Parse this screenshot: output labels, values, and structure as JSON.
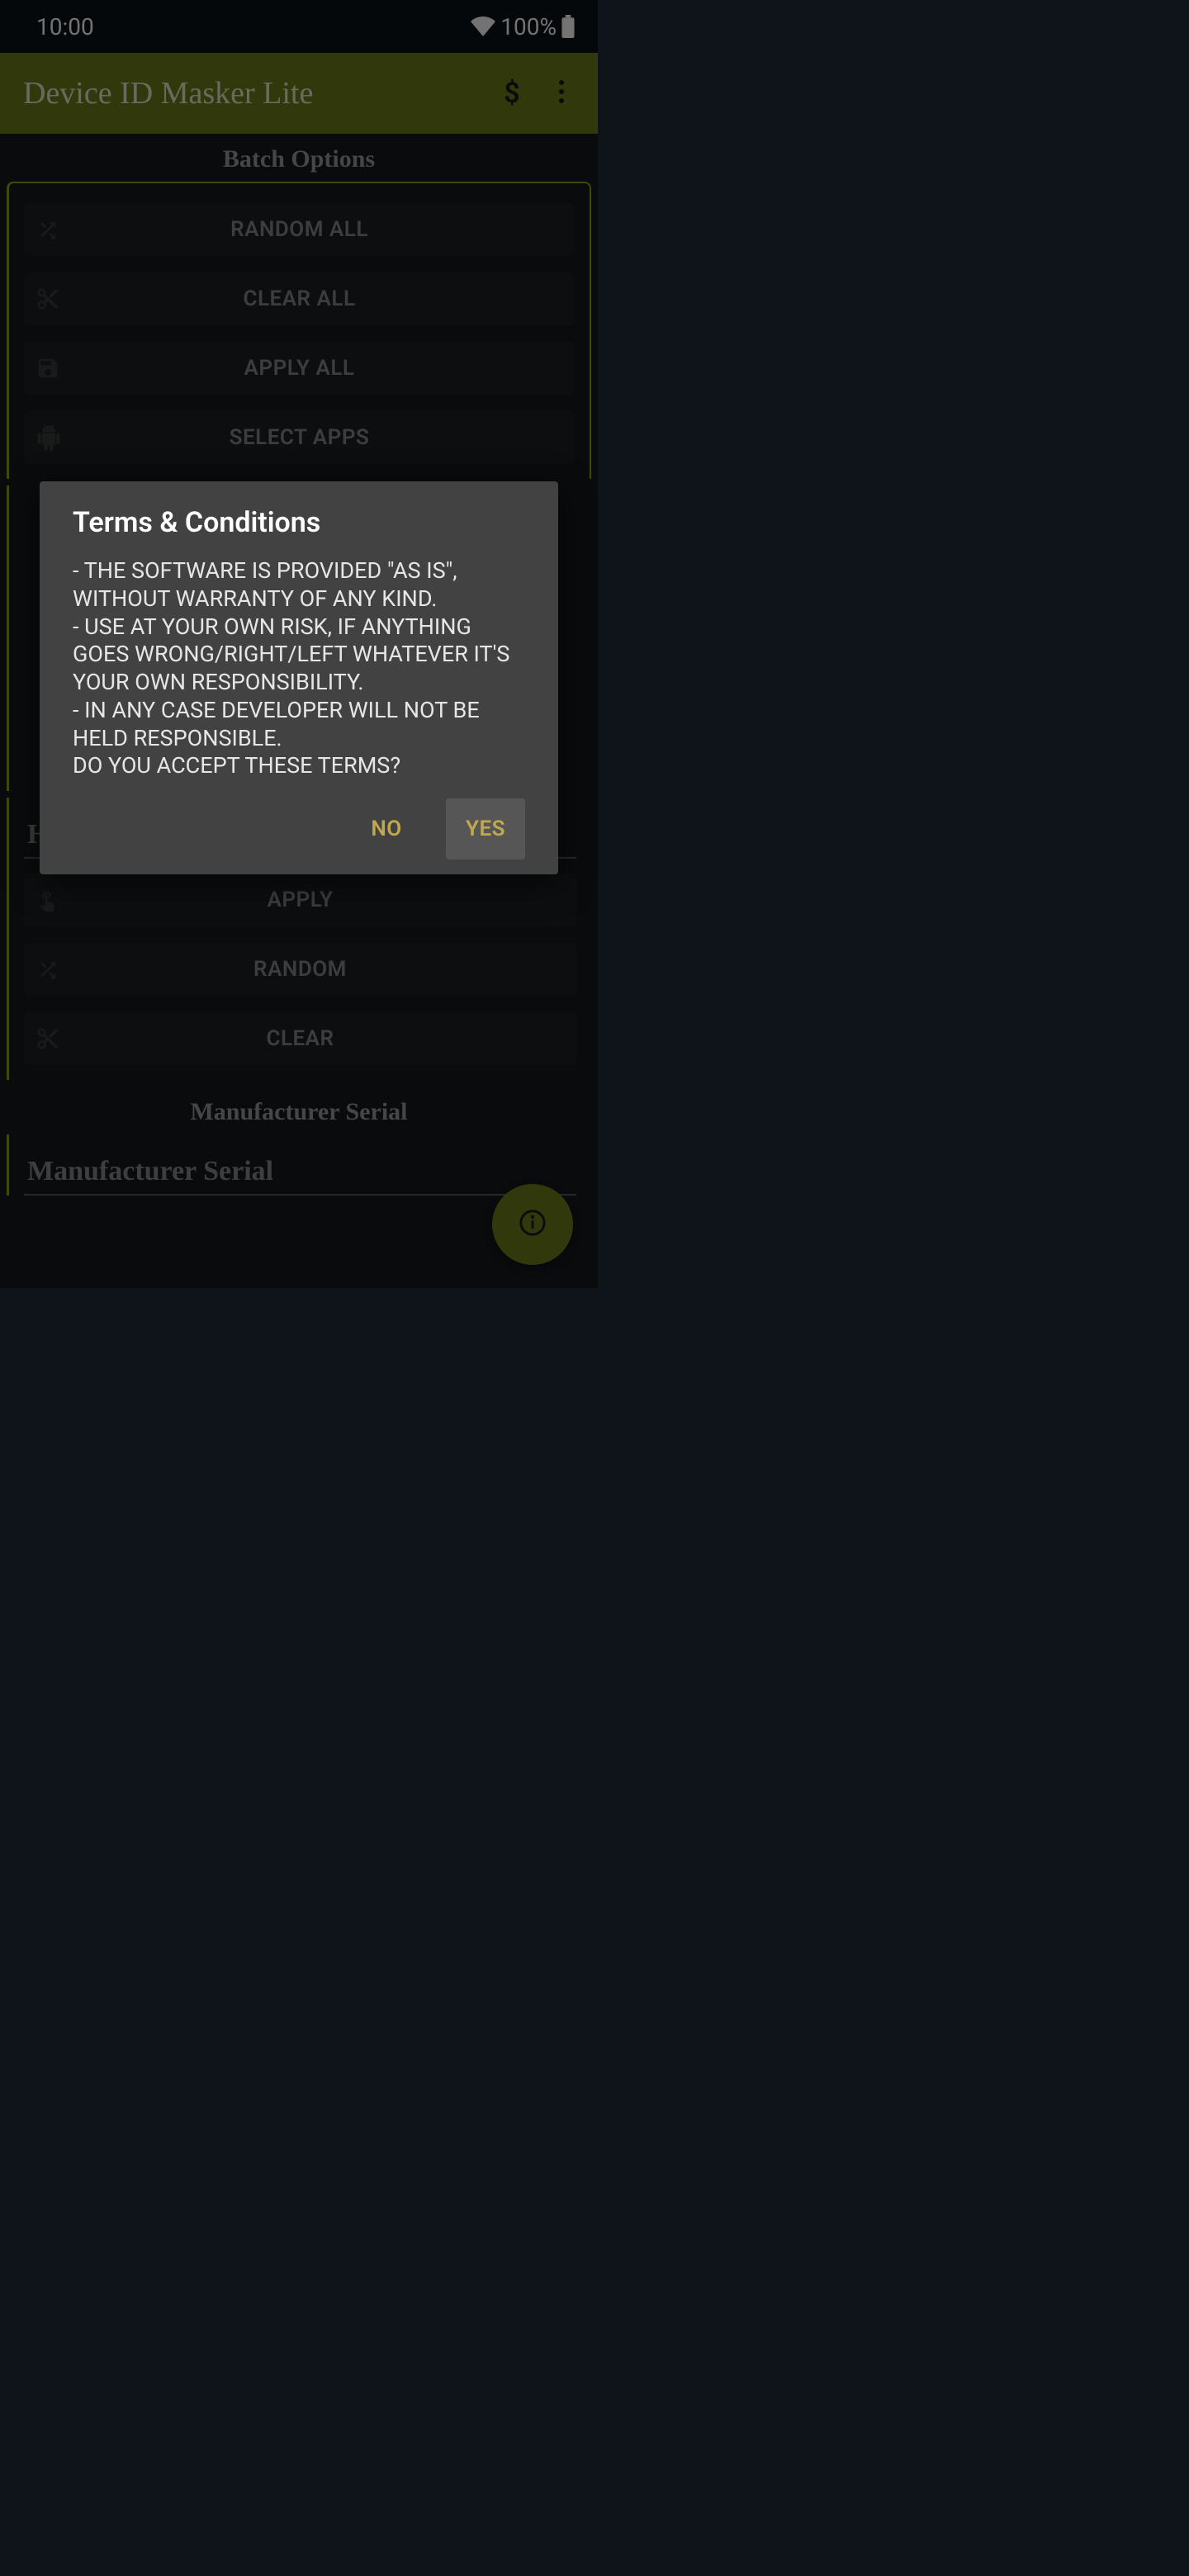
{
  "status": {
    "time": "10:00",
    "battery": "100%"
  },
  "app": {
    "title": "Device ID Masker Lite"
  },
  "sections": {
    "batch_title": "Batch Options",
    "batch": {
      "random_all": "RANDOM ALL",
      "clear_all": "CLEAR ALL",
      "apply_all": "APPLY ALL",
      "select_apps": "SELECT APPS"
    },
    "hw_serial_title": "Hardware Serial",
    "hw": {
      "apply": "APPLY",
      "random": "RANDOM",
      "clear": "CLEAR"
    },
    "mfr_top_title": "Manufacturer Serial",
    "mfr_card_title": "Manufacturer Serial"
  },
  "dialog": {
    "title": "Terms & Conditions",
    "body": "- THE SOFTWARE IS PROVIDED \"AS IS\", WITHOUT WARRANTY OF ANY KIND.\n- USE AT YOUR OWN RISK, IF ANYTHING GOES WRONG/RIGHT/LEFT WHATEVER IT'S YOUR OWN RESPONSIBILITY.\n- IN ANY CASE DEVELOPER WILL NOT BE HELD RESPONSIBLE.\nDO YOU ACCEPT THESE TERMS?",
    "no": "NO",
    "yes": "YES"
  }
}
